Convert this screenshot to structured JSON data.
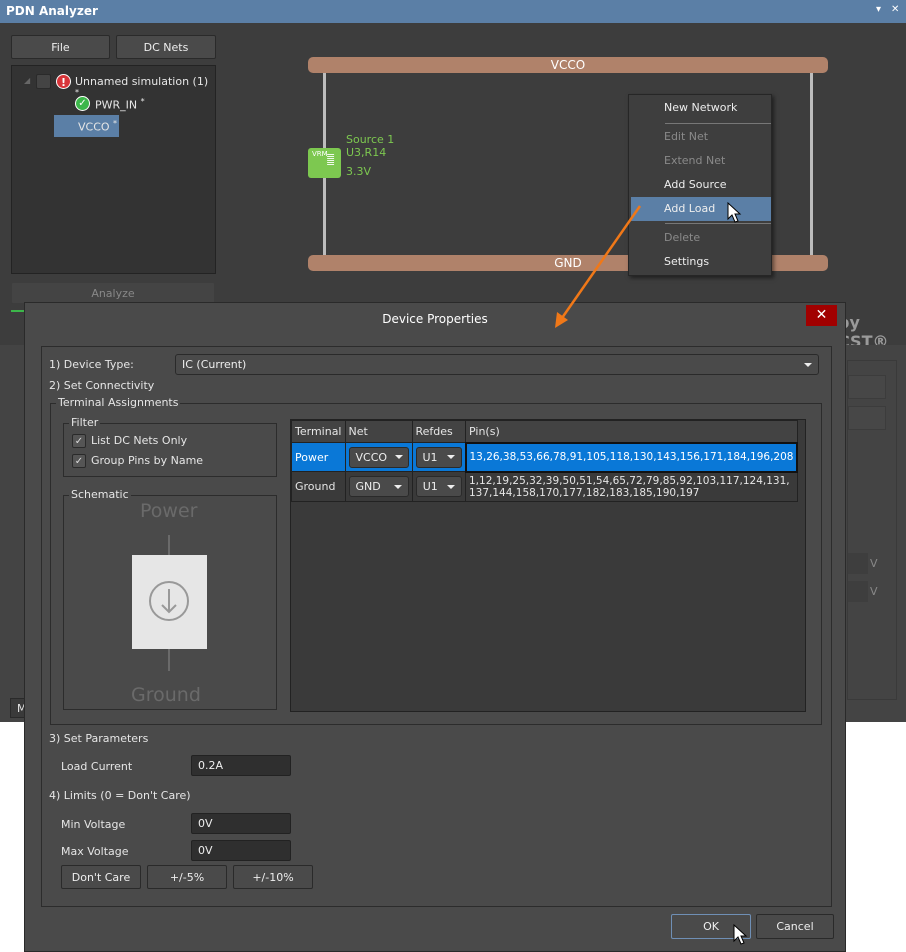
{
  "window": {
    "title": "PDN Analyzer",
    "pin_icon": "pin-icon",
    "close_icon": "close-icon"
  },
  "toolbar": {
    "file": "File",
    "dc_nets": "DC Nets",
    "analyze": "Analyze"
  },
  "tree": [
    {
      "label": "Unnamed simulation (1)",
      "mark": "*",
      "status": "error"
    },
    {
      "label": "PWR_IN",
      "mark": "*",
      "status": "ok"
    },
    {
      "label": "VCCO",
      "mark": "*",
      "selected": true
    }
  ],
  "canvas": {
    "top_rail": "VCCO",
    "bottom_rail": "GND",
    "vrm_label": "VRM",
    "source_name": "Source 1",
    "source_ref": "U3,R14",
    "source_voltage": "3.3V",
    "brand": "by CST®"
  },
  "context_menu": {
    "items": [
      {
        "label": "New Network",
        "enabled": true
      },
      {
        "label": "Edit Net",
        "enabled": false
      },
      {
        "label": "Extend Net",
        "enabled": false
      },
      {
        "label": "Add Source",
        "enabled": true
      },
      {
        "label": "Add Load",
        "enabled": true,
        "highlighted": true
      },
      {
        "label": "Delete",
        "enabled": false
      },
      {
        "label": "Settings",
        "enabled": true
      }
    ]
  },
  "background_tab": "M",
  "background_units": [
    "V",
    "V"
  ],
  "dialog": {
    "title": "Device Properties",
    "device_type_label": "1) Device Type:",
    "device_type_value": "IC (Current)",
    "connectivity_label": "2) Set Connectivity",
    "terminal_assignments": "Terminal Assignments",
    "filter": {
      "title": "Filter",
      "list_dc_nets_only": "List DC Nets Only",
      "group_pins_by_name": "Group Pins by Name",
      "list_checked": true,
      "group_checked": true
    },
    "schematic": {
      "title": "Schematic",
      "top": "Power",
      "bottom": "Ground"
    },
    "table": {
      "headers": [
        "Terminal",
        "Net",
        "Refdes",
        "Pin(s)"
      ],
      "rows": [
        {
          "terminal": "Power",
          "net": "VCCO",
          "refdes": "U1",
          "pins": "13,26,38,53,66,78,91,105,118,130,143,156,171,184,196,208",
          "selected": true
        },
        {
          "terminal": "Ground",
          "net": "GND",
          "refdes": "U1",
          "pins": "1,12,19,25,32,39,50,51,54,65,72,79,85,92,103,117,124,131,137,144,158,170,177,182,183,185,190,197"
        }
      ]
    },
    "parameters_label": "3) Set Parameters",
    "load_current_label": "Load Current",
    "load_current": "0.2A",
    "limits_label": "4) Limits (0 = Don't Care)",
    "min_voltage_label": "Min Voltage",
    "min_voltage": "0V",
    "max_voltage_label": "Max Voltage",
    "max_voltage": "0V",
    "dont_care": "Don't Care",
    "pm5": "+/-5%",
    "pm10": "+/-10%",
    "ok": "OK",
    "cancel": "Cancel"
  },
  "colors": {
    "titlebar": "#5b7fa6",
    "rail": "#b0826a",
    "vrm": "#7dc850",
    "selection": "#0a78d7",
    "arrow": "#f07818",
    "close": "#a10000"
  }
}
